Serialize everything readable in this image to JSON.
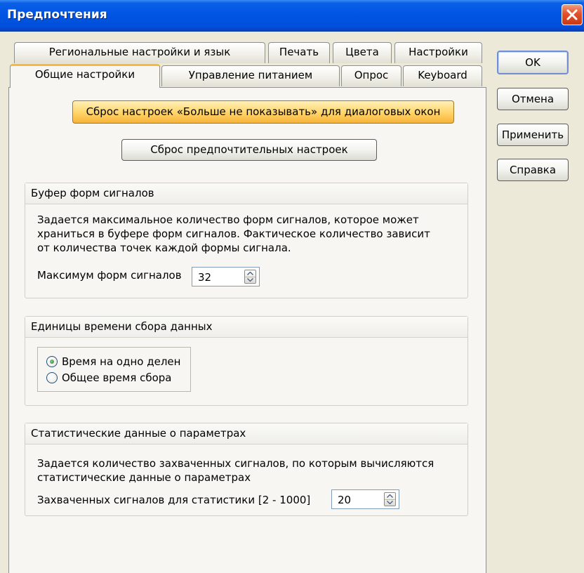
{
  "window": {
    "title": "Предпочтения"
  },
  "tabs": {
    "row1": [
      {
        "label": "Региональные настройки и язык"
      },
      {
        "label": "Печать"
      },
      {
        "label": "Цвета"
      },
      {
        "label": "Настройки"
      }
    ],
    "row2": [
      {
        "label": "Общие настройки",
        "active": true
      },
      {
        "label": "Управление питанием"
      },
      {
        "label": "Опрос"
      },
      {
        "label": "Keyboard"
      }
    ]
  },
  "buttons": {
    "ok": "OK",
    "cancel": "Отмена",
    "apply": "Применить",
    "help": "Справка"
  },
  "general": {
    "reset_dialogs_label": "Сброс настроек «Больше не показывать» для диалоговых окон",
    "reset_prefs_label": "Сброс предпочтительных настроек",
    "buffer": {
      "title": "Буфер форм сигналов",
      "description_lines": [
        "Задается максимальное количество форм сигналов, которое может",
        "храниться в буфере форм сигналов. Фактическое количество зависит",
        "от количества точек каждой формы сигнала."
      ],
      "max_label": "Максимум форм сигналов",
      "max_value": "32"
    },
    "time_units": {
      "title": "Единицы времени сбора данных",
      "options": [
        {
          "label": "Время на одно делен",
          "selected": true
        },
        {
          "label": "Общее время сбора",
          "selected": false
        }
      ]
    },
    "statistics": {
      "title": "Статистические данные о параметрах",
      "description_lines": [
        "Задается количество захваченных сигналов, по которым вычисляются",
        "статистические данные о параметрах"
      ],
      "count_label": "Захваченных сигналов для статистики [2 - 1000]",
      "count_value": "20"
    }
  },
  "colors": {
    "titlebar": "#0054e3",
    "highlight_button": "#ffd467",
    "active_tab_accent": "#f7b93c",
    "close_button": "#e2512a"
  }
}
